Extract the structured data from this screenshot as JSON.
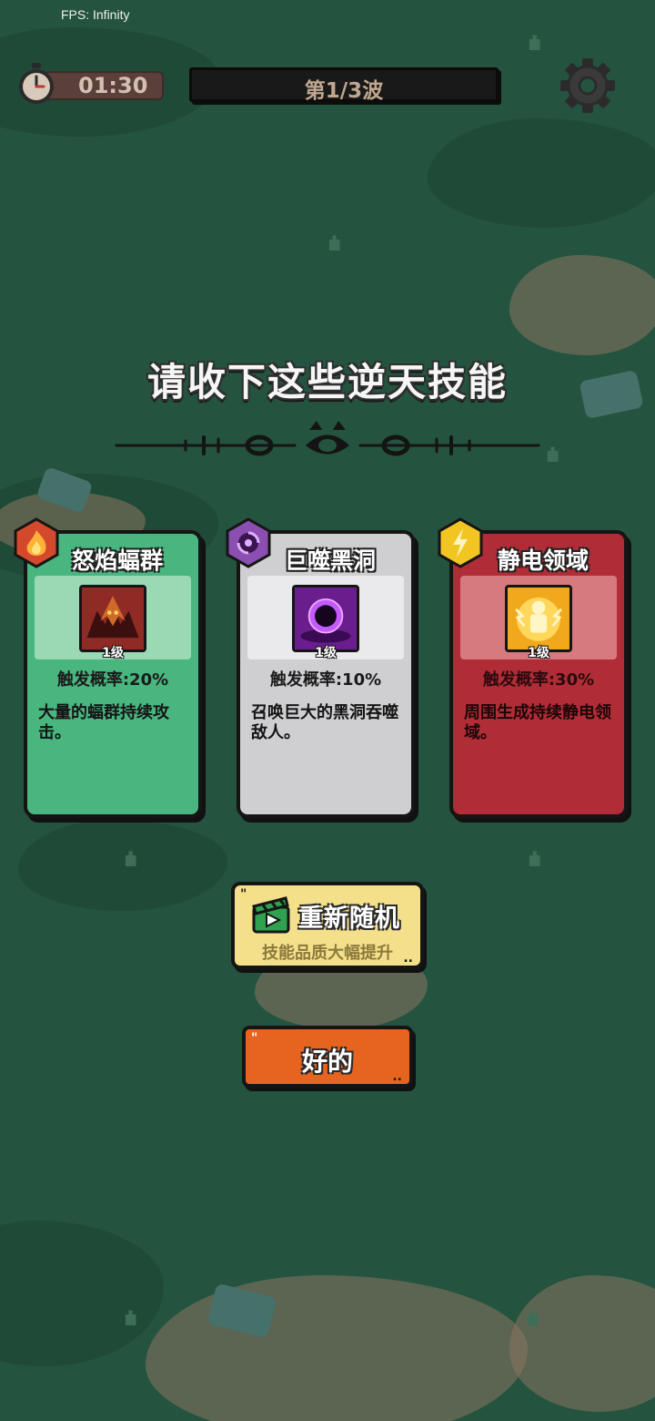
{
  "hud": {
    "fps_label": "FPS: Infinity",
    "timer": "01:30",
    "wave": "第1/3波"
  },
  "headline": "请收下这些逆天技能",
  "cards": [
    {
      "title": "怒焰蝠群",
      "level": "1级",
      "rate": "触发概率:20%",
      "desc": "大量的蝠群持续攻击。",
      "badge_icon": "fire-icon",
      "color": "#49b57f"
    },
    {
      "title": "巨噬黑洞",
      "level": "1级",
      "rate": "触发概率:10%",
      "desc": "召唤巨大的黑洞吞噬敌人。",
      "badge_icon": "vortex-icon",
      "color": "#cfcfd2"
    },
    {
      "title": "静电领域",
      "level": "1级",
      "rate": "触发概率:30%",
      "desc": "周围生成持续静电领域。",
      "badge_icon": "lightning-icon",
      "color": "#b02c36"
    }
  ],
  "reroll": {
    "title": "重新随机",
    "subtitle": "技能品质大幅提升",
    "icon": "video-clapper-icon"
  },
  "confirm": {
    "label": "好的"
  }
}
